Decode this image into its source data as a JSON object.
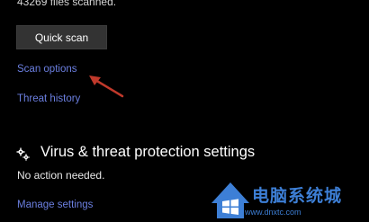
{
  "scan": {
    "files_scanned": "43269 files scanned.",
    "quick_scan_label": "Quick scan",
    "scan_options_label": "Scan options",
    "threat_history_label": "Threat history"
  },
  "settings": {
    "title": "Virus & threat protection settings",
    "status": "No action needed.",
    "manage_label": "Manage settings"
  },
  "watermark": {
    "title": "电脑系统城",
    "url": "www.dnxtc.com"
  },
  "colors": {
    "background": "#000000",
    "link": "#6b7fe0",
    "button": "#333333",
    "annotation_arrow": "#c0392b",
    "watermark": "#3d7fd6"
  }
}
